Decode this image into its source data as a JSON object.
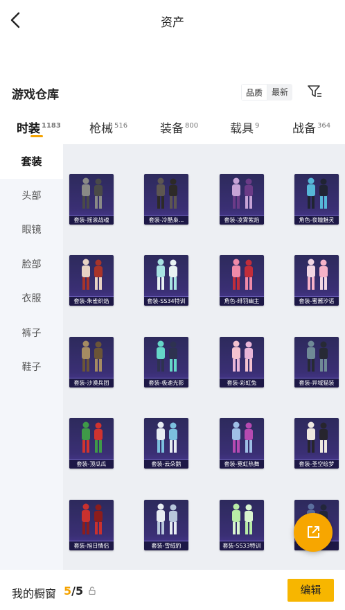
{
  "header": {
    "title": "资产"
  },
  "warehouse": {
    "title": "游戏仓库",
    "sort_options": [
      "品质",
      "最新"
    ],
    "active_sort": 0
  },
  "tabs": [
    {
      "label": "时装",
      "count": "1183"
    },
    {
      "label": "枪械",
      "count": "516"
    },
    {
      "label": "装备",
      "count": "800"
    },
    {
      "label": "载具",
      "count": "9"
    },
    {
      "label": "战备",
      "count": "364"
    }
  ],
  "sidebar": [
    "套装",
    "头部",
    "眼镜",
    "脸部",
    "衣服",
    "裤子",
    "鞋子"
  ],
  "items": [
    {
      "label": "套装-摇滚战魂",
      "palette": [
        "#8a8a86",
        "#4a4a48"
      ]
    },
    {
      "label": "套装-冷酷枭...",
      "palette": [
        "#5d5651",
        "#2d2a28"
      ]
    },
    {
      "label": "套装-凌霄紫焰",
      "palette": [
        "#c7a3d6",
        "#6b3b87"
      ]
    },
    {
      "label": "角色-夜瞳魅灵",
      "palette": [
        "#56b7d8",
        "#202433"
      ]
    },
    {
      "label": "套装-朱雀织焰",
      "palette": [
        "#e8d3c4",
        "#a8342a"
      ]
    },
    {
      "label": "套装-SS34特训",
      "palette": [
        "#a8e3e3",
        "#e8f2f2"
      ]
    },
    {
      "label": "角色-绯羽幽主",
      "palette": [
        "#f08aa8",
        "#c22d3a"
      ]
    },
    {
      "label": "套装-蜜酱汐语",
      "palette": [
        "#f2d6e3",
        "#f7b2c8"
      ]
    },
    {
      "label": "套装-沙漠兵团",
      "palette": [
        "#a58b62",
        "#6b5537"
      ]
    },
    {
      "label": "套装-极速光影",
      "palette": [
        "#65d7c8",
        "#2e3250"
      ]
    },
    {
      "label": "套装-彩虹兔",
      "palette": [
        "#f4c3cf",
        "#e9b6d8"
      ]
    },
    {
      "label": "套装-异域猫装",
      "palette": [
        "#6f8a96",
        "#272a35"
      ]
    },
    {
      "label": "套装-顶瓜瓜",
      "palette": [
        "#3f9a48",
        "#d1332f"
      ]
    },
    {
      "label": "套装-云朵鹅",
      "palette": [
        "#e7edf3",
        "#7cc0de"
      ]
    },
    {
      "label": "套装-霓虹热舞",
      "palette": [
        "#9fc0e6",
        "#b64ab1"
      ]
    },
    {
      "label": "套装-圣空绘梦",
      "palette": [
        "#efe9e0",
        "#27252e"
      ]
    },
    {
      "label": "套装-旭日情侣",
      "palette": [
        "#c9312e",
        "#8c1d1c"
      ]
    },
    {
      "label": "套装-雪绒豹",
      "palette": [
        "#e7ecf2",
        "#b7c6db"
      ]
    },
    {
      "label": "套装-SS33特训",
      "palette": [
        "#b8eca6",
        "#d9f5cf"
      ]
    },
    {
      "label": "...渊",
      "palette": [
        "#5b6f9e",
        "#22263a"
      ]
    }
  ],
  "closet": {
    "label": "我的橱窗",
    "current": "5",
    "separator": "/",
    "max": "5",
    "edit_label": "编辑"
  },
  "colors": {
    "accent": "#f5a300",
    "card_bg": "#2f2a63",
    "content_bg": "#edeff3",
    "sidebar_bg": "#f4f6fa"
  },
  "icons": {
    "back": "chevron-left-icon",
    "filter": "filter-icon",
    "fab": "share-icon",
    "lock": "lock-icon"
  }
}
